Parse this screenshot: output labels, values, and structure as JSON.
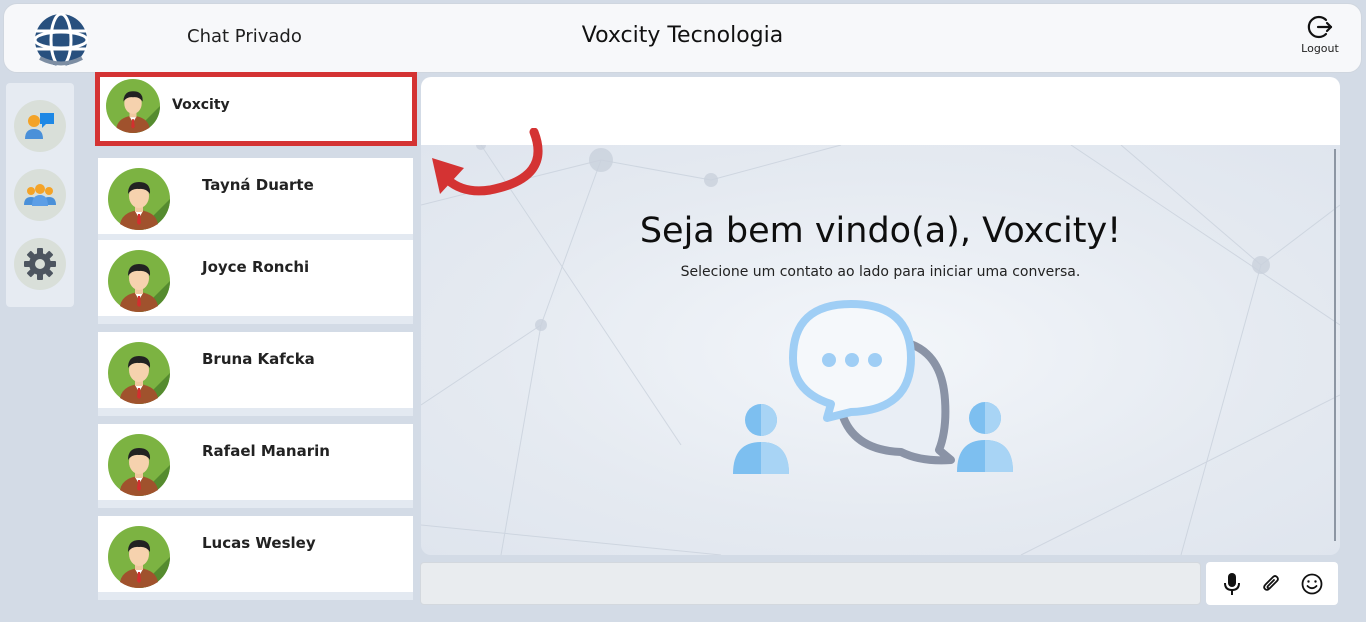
{
  "header": {
    "section_title": "Chat Privado",
    "company": "Voxcity Tecnologia",
    "logout_label": "Logout"
  },
  "rail": {
    "items": [
      {
        "icon": "private-chat-icon"
      },
      {
        "icon": "group-chat-icon"
      },
      {
        "icon": "gear-icon"
      }
    ]
  },
  "contacts": [
    {
      "name": "Voxcity",
      "active": true
    },
    {
      "name": "Tayná Duarte"
    },
    {
      "name": "Joyce Ronchi"
    },
    {
      "name": "Bruna Kafcka"
    },
    {
      "name": "Rafael Manarin"
    },
    {
      "name": "Lucas Wesley"
    }
  ],
  "welcome": {
    "title": "Seja bem vindo(a), Voxcity!",
    "subtitle": "Selecione um contato ao lado para iniciar uma conversa."
  },
  "composer": {
    "value": "",
    "tools": [
      "microphone-icon",
      "paperclip-icon",
      "emoji-icon"
    ]
  },
  "colors": {
    "highlight": "#d43333",
    "background": "#d3dbe6",
    "avatar_green": "#7cb342"
  }
}
